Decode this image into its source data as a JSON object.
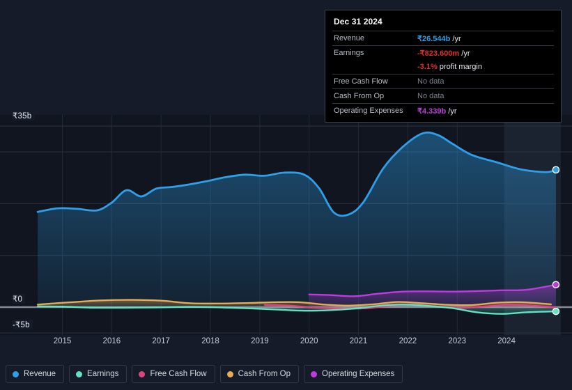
{
  "theme": {
    "background": "#151b28",
    "plot_band": "#10151f",
    "gridline": "#2b3240",
    "zero_axis": "#9aa0ab",
    "recent_band": "#1b2330"
  },
  "tooltip": {
    "date": "Dec 31 2024",
    "rows": [
      {
        "key": "Revenue",
        "value": "₹26.544b",
        "unit": " /yr",
        "color": "#2e9fe8",
        "nodata": false
      },
      {
        "key": "Earnings",
        "value": "-₹823.600m",
        "unit": " /yr",
        "color": "#e03030",
        "nodata": false
      },
      {
        "key": "",
        "value": "-3.1%",
        "unit": " profit margin",
        "color": "#e03030",
        "nodata": false,
        "sub": true
      },
      {
        "key": "Free Cash Flow",
        "value": "No data",
        "unit": "",
        "color": "#7d838f",
        "nodata": true
      },
      {
        "key": "Cash From Op",
        "value": "No data",
        "unit": "",
        "color": "#7d838f",
        "nodata": true
      },
      {
        "key": "Operating Expenses",
        "value": "₹4.339b",
        "unit": " /yr",
        "color": "#c03ae0",
        "nodata": false
      }
    ]
  },
  "legend": {
    "items": [
      {
        "label": "Revenue",
        "color": "#2e9fe8"
      },
      {
        "label": "Earnings",
        "color": "#5fe3c0"
      },
      {
        "label": "Free Cash Flow",
        "color": "#e0447f"
      },
      {
        "label": "Cash From Op",
        "color": "#e8ab52"
      },
      {
        "label": "Operating Expenses",
        "color": "#c03ae0"
      }
    ]
  },
  "chart_data": {
    "type": "area",
    "title": "",
    "xlabel": "",
    "ylabel": "",
    "currency": "INR",
    "grid": true,
    "legend_position": "bottom",
    "ylim": [
      -5,
      35
    ],
    "ytick_labels": [
      "₹35b",
      "₹0",
      "-₹5b"
    ],
    "ytick_values": [
      35,
      0,
      -5
    ],
    "xlim": [
      2014.4,
      2025.1
    ],
    "xtick_labels": [
      "2015",
      "2016",
      "2017",
      "2018",
      "2019",
      "2020",
      "2021",
      "2022",
      "2023",
      "2024"
    ],
    "xtick_values": [
      2015,
      2016,
      2017,
      2018,
      2019,
      2020,
      2021,
      2022,
      2023,
      2024
    ],
    "series": [
      {
        "name": "Revenue",
        "color": "#2e9fe8",
        "x": [
          2014.5,
          2014.9,
          2015.3,
          2015.7,
          2016.0,
          2016.3,
          2016.6,
          2016.9,
          2017.2,
          2017.5,
          2017.9,
          2018.3,
          2018.7,
          2019.1,
          2019.5,
          2019.9,
          2020.2,
          2020.5,
          2020.8,
          2021.1,
          2021.5,
          2021.9,
          2022.3,
          2022.6,
          2022.9,
          2023.3,
          2023.8,
          2024.3,
          2024.8,
          2025.0
        ],
        "values": [
          18.4,
          19.1,
          19.0,
          18.7,
          20.2,
          22.6,
          21.4,
          22.9,
          23.2,
          23.6,
          24.3,
          25.1,
          25.6,
          25.4,
          26.0,
          25.6,
          23.0,
          18.3,
          17.9,
          20.3,
          26.8,
          31.0,
          33.6,
          33.3,
          31.6,
          29.4,
          28.0,
          26.6,
          26.1,
          26.544
        ]
      },
      {
        "name": "Earnings",
        "color": "#5fe3c0",
        "x": [
          2014.5,
          2015.0,
          2015.6,
          2016.2,
          2016.9,
          2017.6,
          2018.2,
          2018.8,
          2019.4,
          2019.9,
          2020.4,
          2020.9,
          2021.4,
          2021.9,
          2022.4,
          2022.9,
          2023.4,
          2023.9,
          2024.4,
          2025.0
        ],
        "values": [
          0.15,
          0.1,
          -0.1,
          -0.1,
          -0.05,
          0.05,
          -0.05,
          -0.25,
          -0.5,
          -0.7,
          -0.6,
          -0.3,
          0.25,
          0.5,
          0.25,
          -0.2,
          -1.0,
          -1.3,
          -1.0,
          -0.824
        ]
      },
      {
        "name": "Free Cash Flow",
        "color": "#e0447f",
        "x": [
          2019.1,
          2019.6,
          2020.1,
          2020.6,
          2021.1,
          2021.6,
          2022.0,
          2022.5,
          2023.0,
          2023.5,
          2024.0,
          2024.5,
          2025.0
        ],
        "values": [
          0.45,
          0.3,
          -0.1,
          -0.25,
          -0.25,
          0.2,
          0.5,
          0.2,
          -0.15,
          0.1,
          0.45,
          0.3,
          -0.05
        ]
      },
      {
        "name": "Cash From Op",
        "color": "#e8ab52",
        "x": [
          2014.5,
          2015.1,
          2015.8,
          2016.4,
          2017.0,
          2017.6,
          2018.2,
          2018.8,
          2019.3,
          2019.8,
          2020.3,
          2020.8,
          2021.3,
          2021.8,
          2022.3,
          2022.8,
          2023.3,
          2023.8,
          2024.3,
          2024.9
        ],
        "values": [
          0.5,
          0.9,
          1.3,
          1.4,
          1.25,
          0.75,
          0.7,
          0.8,
          0.95,
          0.95,
          0.5,
          0.3,
          0.55,
          1.0,
          0.75,
          0.45,
          0.4,
          0.85,
          0.95,
          0.55
        ]
      },
      {
        "name": "Operating Expenses",
        "color": "#c03ae0",
        "x": [
          2020.0,
          2020.4,
          2020.9,
          2021.4,
          2021.9,
          2022.4,
          2022.9,
          2023.4,
          2023.9,
          2024.4,
          2025.0
        ],
        "values": [
          2.45,
          2.35,
          2.1,
          2.6,
          3.0,
          3.05,
          3.0,
          3.1,
          3.25,
          3.35,
          4.339
        ]
      }
    ],
    "endpoint_markers": [
      {
        "series": "Revenue",
        "color": "#2e9fe8"
      },
      {
        "series": "Operating Expenses",
        "color": "#c03ae0"
      },
      {
        "series": "Earnings",
        "color": "#5fe3c0"
      }
    ],
    "recent_band_start": 2023.95
  }
}
